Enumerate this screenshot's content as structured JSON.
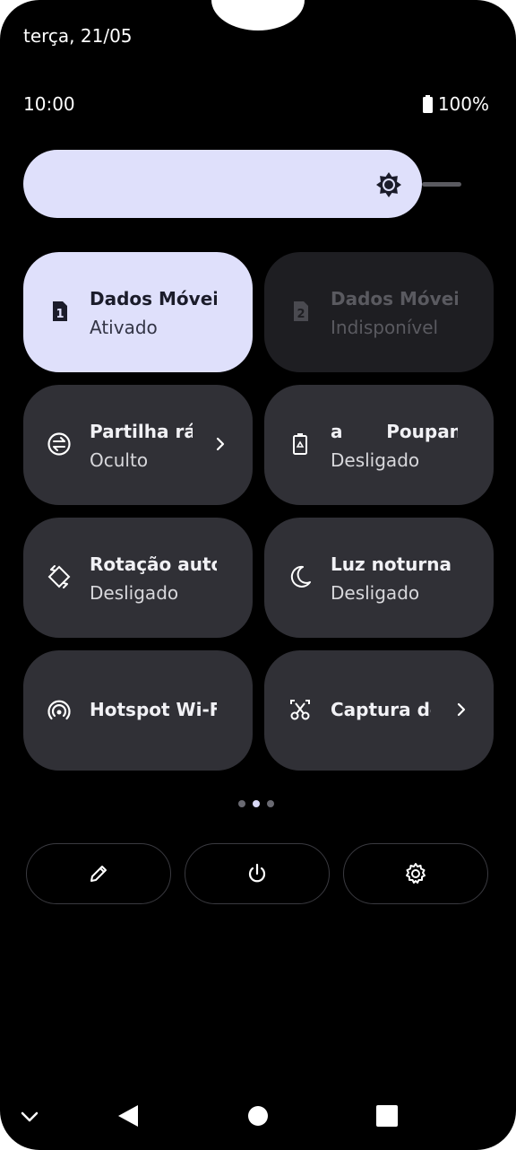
{
  "status_bar": {
    "date": "terça, 21/05",
    "time": "10:00",
    "battery": "100%"
  },
  "brightness": {
    "icon": "brightness-icon",
    "level": 0.9
  },
  "tiles": [
    {
      "id": "mobile-data-1",
      "icon": "sim1-icon",
      "title": "Dados Móveis",
      "subtitle": "Ativado",
      "state": "active"
    },
    {
      "id": "mobile-data-2",
      "icon": "sim2-icon",
      "title": "Dados Móveis",
      "subtitle": "Indisponível",
      "state": "disabled"
    },
    {
      "id": "quick-share",
      "icon": "quick-share-icon",
      "title": "Partilha ráp",
      "subtitle": "Oculto",
      "state": "off",
      "chevron": true
    },
    {
      "id": "battery-saver",
      "icon": "battery-saver-icon",
      "title": "a       Poupanc",
      "subtitle": "Desligado",
      "state": "off"
    },
    {
      "id": "auto-rotate",
      "icon": "rotate-icon",
      "title": "Rotação auto.",
      "subtitle": "Desligado",
      "state": "off"
    },
    {
      "id": "night-light",
      "icon": "moon-icon",
      "title": "Luz noturna",
      "subtitle": "Desligado",
      "state": "off"
    },
    {
      "id": "hotspot",
      "icon": "hotspot-icon",
      "title": "Hotspot Wi-Fi",
      "state": "off"
    },
    {
      "id": "screen-capture",
      "icon": "screenshot-icon",
      "title": "Captura de",
      "state": "off",
      "chevron": true
    }
  ],
  "page_dots": {
    "count": 3,
    "active_index": 1
  },
  "actions": [
    {
      "id": "edit",
      "icon": "pencil-icon"
    },
    {
      "id": "power",
      "icon": "power-icon"
    },
    {
      "id": "settings",
      "icon": "gear-icon"
    }
  ],
  "nav": [
    "collapse-chevron-icon",
    "back-icon",
    "home-icon",
    "recents-icon"
  ],
  "colors": {
    "active_tile": "#dfe0fb",
    "tile": "#303036",
    "disabled_tile": "#1e1e22",
    "background": "#000000"
  }
}
